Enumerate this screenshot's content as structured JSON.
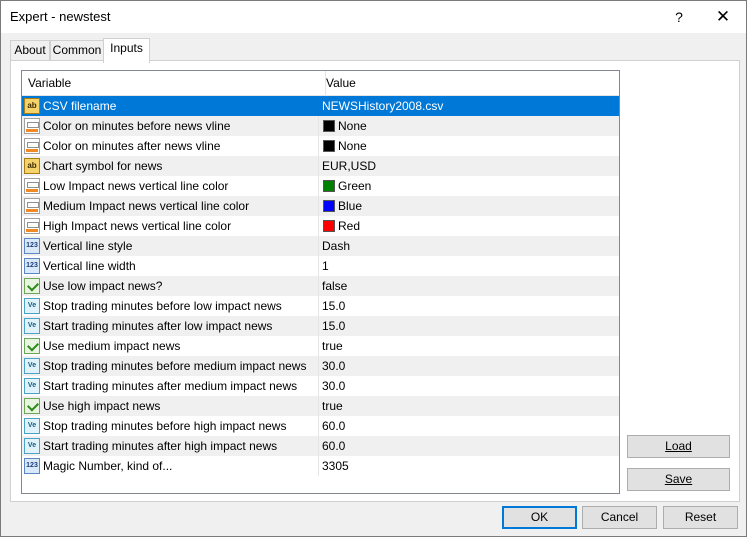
{
  "window": {
    "title": "Expert - newstest",
    "help_glyph": "?",
    "close_glyph": "✕"
  },
  "tabs": [
    {
      "label": "About"
    },
    {
      "label": "Common"
    },
    {
      "label": "Inputs",
      "active": true
    }
  ],
  "grid": {
    "col_variable": "Variable",
    "col_value": "Value",
    "rows": [
      {
        "icon": "string-ab-icon",
        "variable": "CSV filename",
        "value": "NEWSHistory2008.csv",
        "selected": true
      },
      {
        "icon": "color-icon",
        "variable": "Color on minutes before news vline",
        "value": "None",
        "swatch": "#000000"
      },
      {
        "icon": "color-icon",
        "variable": "Color on minutes after news vline",
        "value": "None",
        "swatch": "#000000"
      },
      {
        "icon": "string-ab-icon",
        "variable": "Chart symbol for news",
        "value": "EUR,USD"
      },
      {
        "icon": "color-icon",
        "variable": "Low Impact news vertical line  color",
        "value": "Green",
        "swatch": "#008000"
      },
      {
        "icon": "color-icon",
        "variable": "Medium Impact news vertical line  color",
        "value": "Blue",
        "swatch": "#0000ff"
      },
      {
        "icon": "color-icon",
        "variable": "High Impact news vertical line color",
        "value": "Red",
        "swatch": "#ff0000"
      },
      {
        "icon": "integer-123-icon",
        "variable": "Vertical line style",
        "value": "Dash"
      },
      {
        "icon": "integer-123-icon",
        "variable": "Vertical line width",
        "value": "1"
      },
      {
        "icon": "bool-icon",
        "variable": "Use low impact news?",
        "value": "false"
      },
      {
        "icon": "double-ve-icon",
        "variable": "Stop trading minutes before  low impact news",
        "value": "15.0"
      },
      {
        "icon": "double-ve-icon",
        "variable": "Start trading minutes after low impact news",
        "value": "15.0"
      },
      {
        "icon": "bool-icon",
        "variable": "Use medium impact news",
        "value": "true"
      },
      {
        "icon": "double-ve-icon",
        "variable": "Stop trading minutes before medium impact news",
        "value": "30.0"
      },
      {
        "icon": "double-ve-icon",
        "variable": "Start trading minutes after medium impact news",
        "value": "30.0"
      },
      {
        "icon": "bool-icon",
        "variable": "Use high impact news",
        "value": "true"
      },
      {
        "icon": "double-ve-icon",
        "variable": "Stop trading minutes before high impact news",
        "value": "60.0"
      },
      {
        "icon": "double-ve-icon",
        "variable": "Start trading minutes after high impact news",
        "value": "60.0"
      },
      {
        "icon": "integer-123-icon",
        "variable": "Magic Number, kind of...",
        "value": "3305"
      }
    ]
  },
  "side_buttons": {
    "load": "Load",
    "save": "Save"
  },
  "footer_buttons": {
    "ok": "OK",
    "cancel": "Cancel",
    "reset": "Reset"
  },
  "icon_text": {
    "ab": "ab",
    "num": "123",
    "ve": "Ve"
  },
  "colors": {
    "selection": "#0078d7",
    "alt_row": "#f0f0f0"
  }
}
